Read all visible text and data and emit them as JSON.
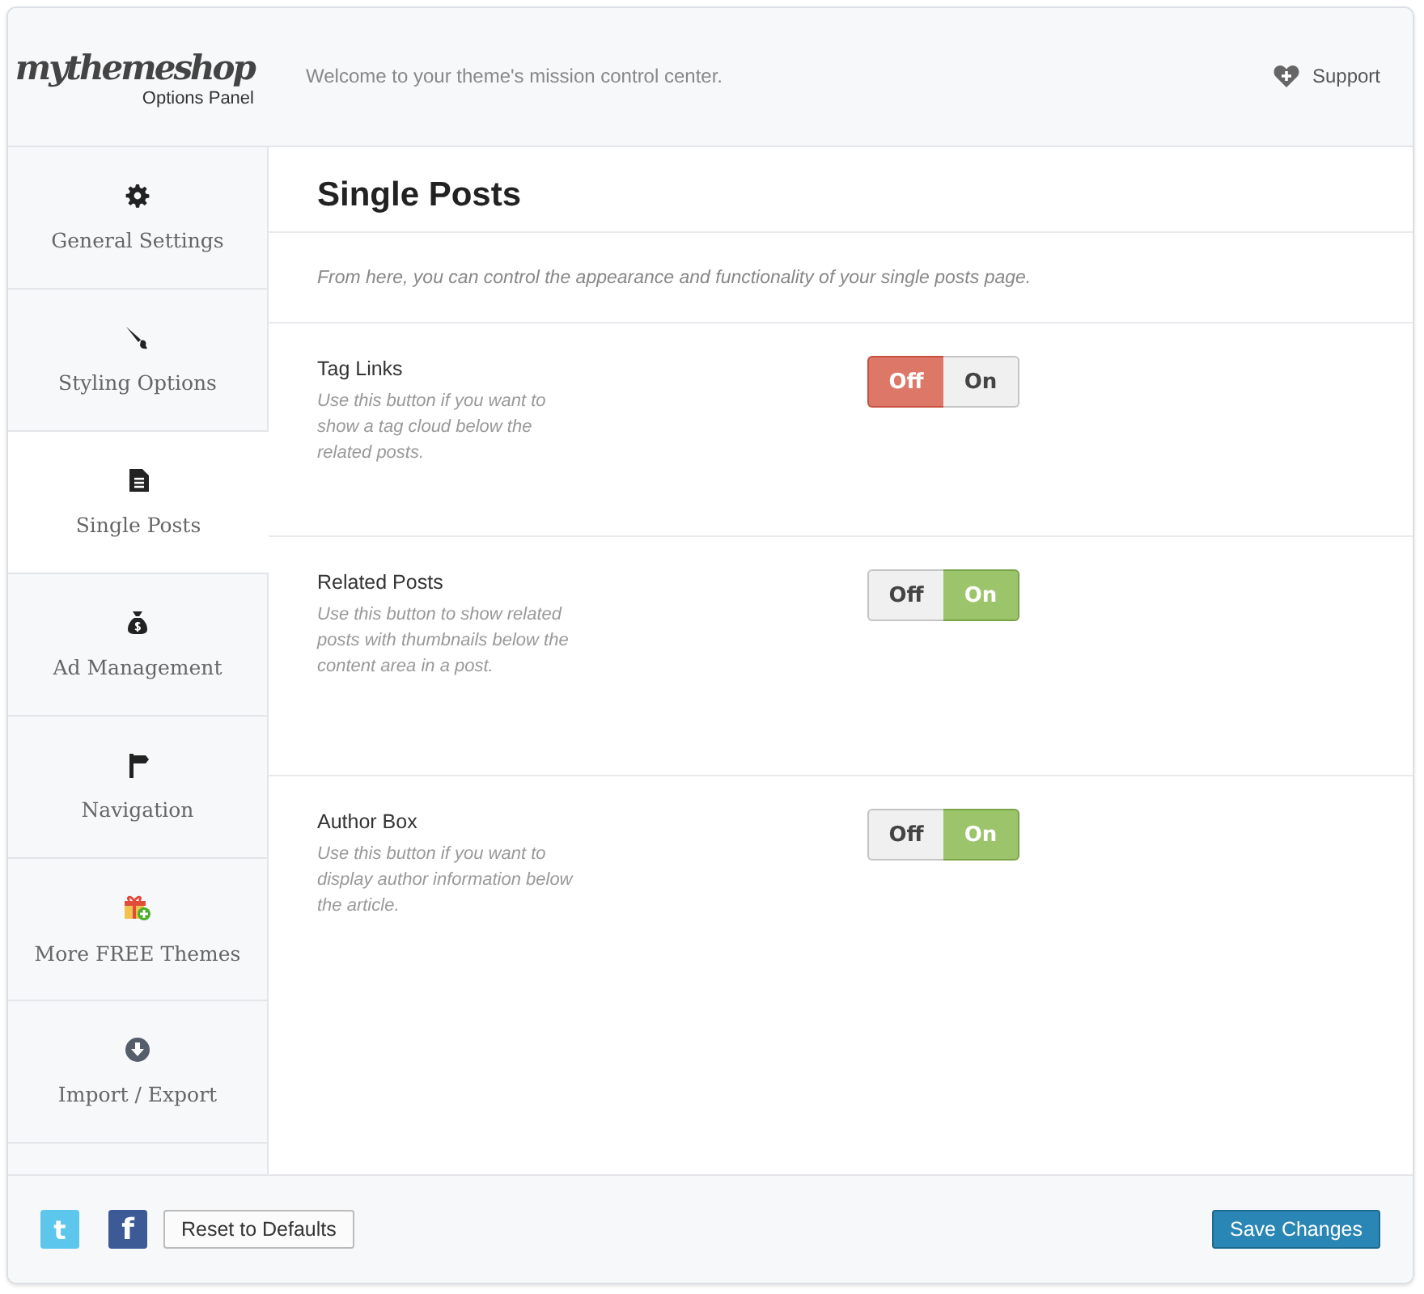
{
  "header": {
    "logo": "mythemeshop",
    "logo_subtitle": "Options Panel",
    "welcome": "Welcome to your theme's mission control center.",
    "support": "Support"
  },
  "sidebar": {
    "items": [
      {
        "label": "General Settings",
        "selected": false
      },
      {
        "label": "Styling Options",
        "selected": false
      },
      {
        "label": "Single Posts",
        "selected": true
      },
      {
        "label": "Ad Management",
        "selected": false
      },
      {
        "label": "Navigation",
        "selected": false
      },
      {
        "label": "More FREE Themes",
        "selected": false
      },
      {
        "label": "Import / Export",
        "selected": false
      }
    ]
  },
  "content": {
    "title": "Single Posts",
    "description": "From here, you can control the appearance and functionality of your single posts page.",
    "options": [
      {
        "label": "Tag Links",
        "help": "Use this button if you want to show a tag cloud below the related posts.",
        "off_label": "Off",
        "on_label": "On",
        "on": false
      },
      {
        "label": "Related Posts",
        "help": "Use this button to show related posts with thumbnails below the content area in a post.",
        "off_label": "Off",
        "on_label": "On",
        "on": true
      },
      {
        "label": "Author Box",
        "help": "Use this button if you want to display author information below the article.",
        "off_label": "Off",
        "on_label": "On",
        "on": true
      }
    ]
  },
  "footer": {
    "twitter": "t",
    "facebook": "f",
    "reset": "Reset to Defaults",
    "save": "Save Changes"
  }
}
